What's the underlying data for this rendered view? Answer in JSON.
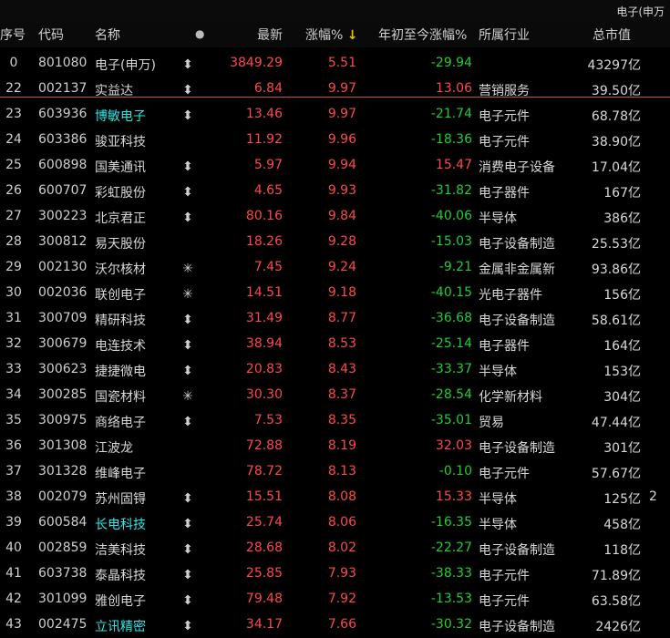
{
  "window": {
    "title": "电子(申万"
  },
  "columns": {
    "idx": "序号",
    "code": "代码",
    "name": "名称",
    "dot": "●",
    "price": "最新",
    "change": "涨幅%",
    "sort_arrow": "↓",
    "ytd": "年初至今涨幅%",
    "industry": "所属行业",
    "cap": "总市值"
  },
  "colors": {
    "up": "#ff4848",
    "down": "#22cc33",
    "highlight": "#2ee6e6",
    "arrow": "#e8c400",
    "separator": "#c05050"
  },
  "rows": [
    {
      "idx": "0",
      "code": "801080",
      "name": "电子(申万)",
      "mark": "⬍",
      "price": "3849.29",
      "change": "5.51",
      "ytd": "-29.94",
      "industry": "",
      "cap": "43297亿",
      "extra": "",
      "cyan": false
    },
    {
      "idx": "22",
      "code": "002137",
      "name": "实益达",
      "mark": "⬍",
      "price": "6.84",
      "change": "9.97",
      "ytd": "13.06",
      "industry": "营销服务",
      "cap": "39.50亿",
      "extra": "",
      "cyan": false
    },
    {
      "idx": "23",
      "code": "603936",
      "name": "博敏电子",
      "mark": "⬍",
      "price": "13.46",
      "change": "9.97",
      "ytd": "-21.74",
      "industry": "电子元件",
      "cap": "68.78亿",
      "extra": "",
      "cyan": true
    },
    {
      "idx": "24",
      "code": "603386",
      "name": "骏亚科技",
      "mark": "",
      "price": "11.92",
      "change": "9.96",
      "ytd": "-18.36",
      "industry": "电子元件",
      "cap": "38.90亿",
      "extra": "",
      "cyan": false
    },
    {
      "idx": "25",
      "code": "600898",
      "name": "国美通讯",
      "mark": "⬍",
      "price": "5.97",
      "change": "9.94",
      "ytd": "15.47",
      "industry": "消费电子设备",
      "cap": "17.04亿",
      "extra": "",
      "cyan": false
    },
    {
      "idx": "26",
      "code": "600707",
      "name": "彩虹股份",
      "mark": "⬍",
      "price": "4.65",
      "change": "9.93",
      "ytd": "-31.82",
      "industry": "电子器件",
      "cap": "167亿",
      "extra": "",
      "cyan": false
    },
    {
      "idx": "27",
      "code": "300223",
      "name": "北京君正",
      "mark": "⬍",
      "price": "80.16",
      "change": "9.84",
      "ytd": "-40.06",
      "industry": "半导体",
      "cap": "386亿",
      "extra": "",
      "cyan": false
    },
    {
      "idx": "28",
      "code": "300812",
      "name": "易天股份",
      "mark": "",
      "price": "18.26",
      "change": "9.28",
      "ytd": "-15.03",
      "industry": "电子设备制造",
      "cap": "25.53亿",
      "extra": "",
      "cyan": false
    },
    {
      "idx": "29",
      "code": "002130",
      "name": "沃尔核材",
      "mark": "✳",
      "price": "7.45",
      "change": "9.24",
      "ytd": "-9.21",
      "industry": "金属非金属新",
      "cap": "93.86亿",
      "extra": "",
      "cyan": false
    },
    {
      "idx": "30",
      "code": "002036",
      "name": "联创电子",
      "mark": "✳",
      "price": "14.51",
      "change": "9.18",
      "ytd": "-40.15",
      "industry": "光电子器件",
      "cap": "156亿",
      "extra": "",
      "cyan": false
    },
    {
      "idx": "31",
      "code": "300709",
      "name": "精研科技",
      "mark": "⬍",
      "price": "31.49",
      "change": "8.77",
      "ytd": "-36.68",
      "industry": "电子设备制造",
      "cap": "58.61亿",
      "extra": "",
      "cyan": false
    },
    {
      "idx": "32",
      "code": "300679",
      "name": "电连技术",
      "mark": "⬍",
      "price": "38.94",
      "change": "8.53",
      "ytd": "-25.14",
      "industry": "电子器件",
      "cap": "164亿",
      "extra": "",
      "cyan": false
    },
    {
      "idx": "33",
      "code": "300623",
      "name": "捷捷微电",
      "mark": "⬍",
      "price": "20.83",
      "change": "8.43",
      "ytd": "-33.37",
      "industry": "半导体",
      "cap": "153亿",
      "extra": "",
      "cyan": false
    },
    {
      "idx": "34",
      "code": "300285",
      "name": "国瓷材料",
      "mark": "✳",
      "price": "30.30",
      "change": "8.37",
      "ytd": "-28.54",
      "industry": "化学新材料",
      "cap": "304亿",
      "extra": "",
      "cyan": false
    },
    {
      "idx": "35",
      "code": "300975",
      "name": "商络电子",
      "mark": "⬍",
      "price": "7.53",
      "change": "8.35",
      "ytd": "-35.01",
      "industry": "贸易",
      "cap": "47.44亿",
      "extra": "",
      "cyan": false
    },
    {
      "idx": "36",
      "code": "301308",
      "name": "江波龙",
      "mark": "",
      "price": "72.88",
      "change": "8.19",
      "ytd": "32.03",
      "industry": "电子设备制造",
      "cap": "301亿",
      "extra": "",
      "cyan": false
    },
    {
      "idx": "37",
      "code": "301328",
      "name": "维峰电子",
      "mark": "",
      "price": "78.72",
      "change": "8.13",
      "ytd": "-0.10",
      "industry": "电子元件",
      "cap": "57.67亿",
      "extra": "",
      "cyan": false
    },
    {
      "idx": "38",
      "code": "002079",
      "name": "苏州固锝",
      "mark": "⬍",
      "price": "15.51",
      "change": "8.08",
      "ytd": "15.33",
      "industry": "半导体",
      "cap": "125亿",
      "extra": "2",
      "cyan": false
    },
    {
      "idx": "39",
      "code": "600584",
      "name": "长电科技",
      "mark": "⬍",
      "price": "25.74",
      "change": "8.06",
      "ytd": "-16.35",
      "industry": "半导体",
      "cap": "458亿",
      "extra": "",
      "cyan": true
    },
    {
      "idx": "40",
      "code": "002859",
      "name": "洁美科技",
      "mark": "⬍",
      "price": "28.68",
      "change": "8.02",
      "ytd": "-22.27",
      "industry": "电子设备制造",
      "cap": "118亿",
      "extra": "",
      "cyan": false
    },
    {
      "idx": "41",
      "code": "603738",
      "name": "泰晶科技",
      "mark": "⬍",
      "price": "25.85",
      "change": "7.93",
      "ytd": "-38.33",
      "industry": "电子元件",
      "cap": "71.89亿",
      "extra": "",
      "cyan": false
    },
    {
      "idx": "42",
      "code": "301099",
      "name": "雅创电子",
      "mark": "⬍",
      "price": "79.48",
      "change": "7.92",
      "ytd": "-13.53",
      "industry": "电子元件",
      "cap": "63.58亿",
      "extra": "",
      "cyan": false
    },
    {
      "idx": "43",
      "code": "002475",
      "name": "立讯精密",
      "mark": "⬍",
      "price": "34.17",
      "change": "7.66",
      "ytd": "-30.32",
      "industry": "电子设备制造",
      "cap": "2426亿",
      "extra": "",
      "cyan": true
    }
  ]
}
